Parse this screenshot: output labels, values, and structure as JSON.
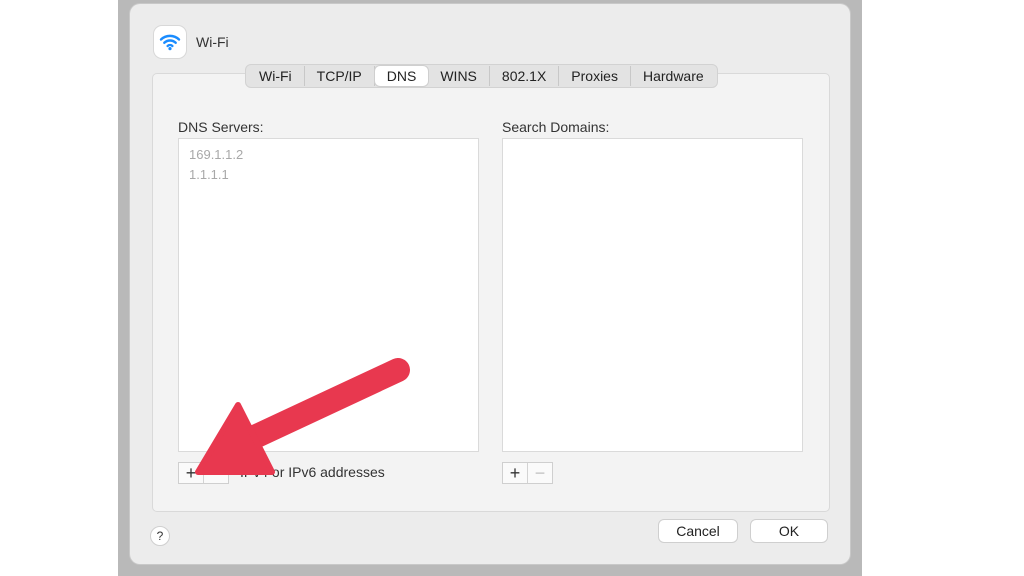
{
  "window": {
    "title": "Wi-Fi",
    "icon": "wifi-icon"
  },
  "tabs": [
    {
      "label": "Wi-Fi"
    },
    {
      "label": "TCP/IP"
    },
    {
      "label": "DNS",
      "selected": true
    },
    {
      "label": "WINS"
    },
    {
      "label": "802.1X"
    },
    {
      "label": "Proxies"
    },
    {
      "label": "Hardware"
    }
  ],
  "dns": {
    "label": "DNS Servers:",
    "servers": [
      "169.1.1.2",
      "1.1.1.1"
    ],
    "add_label": "+",
    "remove_label": "−",
    "hint": "IPv4 or IPv6 addresses"
  },
  "search_domains": {
    "label": "Search Domains:",
    "add_label": "+",
    "remove_label": "−"
  },
  "footer": {
    "help_label": "?",
    "cancel_label": "Cancel",
    "ok_label": "OK"
  },
  "colors": {
    "accent_blue": "#1a8cff",
    "annotation_red": "#e8384f"
  }
}
